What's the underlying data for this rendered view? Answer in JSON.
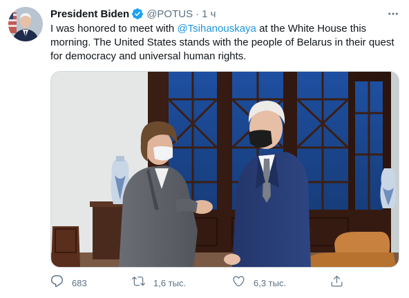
{
  "tweet": {
    "author_name": "President Biden",
    "handle": "@POTUS",
    "separator": "·",
    "time": "1 ч",
    "text_before": "I was honored to meet with ",
    "mention": "@Tsihanouskaya",
    "text_after": " at the White House this morning. The United States stands with the people of Belarus in their quest for democracy and universal human rights."
  },
  "actions": {
    "replies": "683",
    "retweets": "1,6 тыс.",
    "likes": "6,3 тыс."
  },
  "colors": {
    "accent": "#1da1f2",
    "link": "#1b95e0",
    "secondary_text": "#5b7083"
  },
  "icons": [
    "verified-badge-icon",
    "more-options-icon",
    "reply-icon",
    "retweet-icon",
    "like-icon",
    "share-icon"
  ]
}
